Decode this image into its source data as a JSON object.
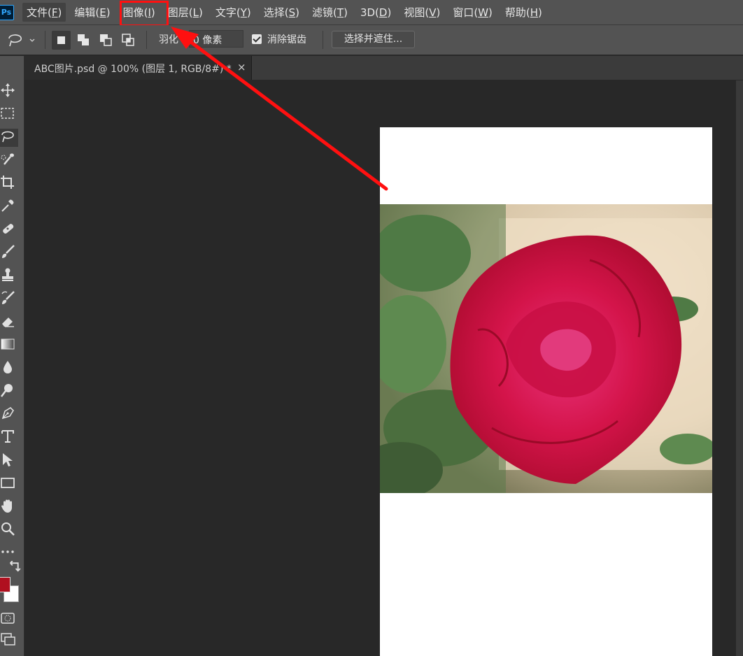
{
  "app": {
    "logo": "Ps"
  },
  "menu": [
    {
      "id": "file",
      "text": "文件",
      "key": "F"
    },
    {
      "id": "edit",
      "text": "编辑",
      "key": "E"
    },
    {
      "id": "image",
      "text": "图像",
      "key": "I"
    },
    {
      "id": "layer",
      "text": "图层",
      "key": "L"
    },
    {
      "id": "type",
      "text": "文字",
      "key": "Y"
    },
    {
      "id": "select",
      "text": "选择",
      "key": "S"
    },
    {
      "id": "filter",
      "text": "滤镜",
      "key": "T"
    },
    {
      "id": "3d",
      "text": "3D",
      "key": "D"
    },
    {
      "id": "view",
      "text": "视图",
      "key": "V"
    },
    {
      "id": "window",
      "text": "窗口",
      "key": "W"
    },
    {
      "id": "help",
      "text": "帮助",
      "key": "H"
    }
  ],
  "options": {
    "feather_label": "羽化",
    "feather_value": "0 像素",
    "antialias_label": "消除锯齿",
    "antialias_checked": true,
    "select_mask_label": "选择并遮住..."
  },
  "document_tab": {
    "title": "ABC图片.psd @ 100% (图层 1, RGB/8#) *",
    "close": "×"
  },
  "colors": {
    "foreground": "#b0101f",
    "background": "#ffffff",
    "annotation": "#ff1010"
  },
  "tools": [
    "move-icon",
    "marquee-icon",
    "lasso-icon",
    "quick-select-icon",
    "crop-icon",
    "eyedropper-icon",
    "healing-icon",
    "brush-icon",
    "stamp-icon",
    "history-brush-icon",
    "eraser-icon",
    "gradient-icon",
    "blur-icon",
    "dodge-icon",
    "pen-icon",
    "type-icon",
    "path-select-icon",
    "rectangle-icon",
    "hand-icon",
    "zoom-icon",
    "more-icon"
  ]
}
